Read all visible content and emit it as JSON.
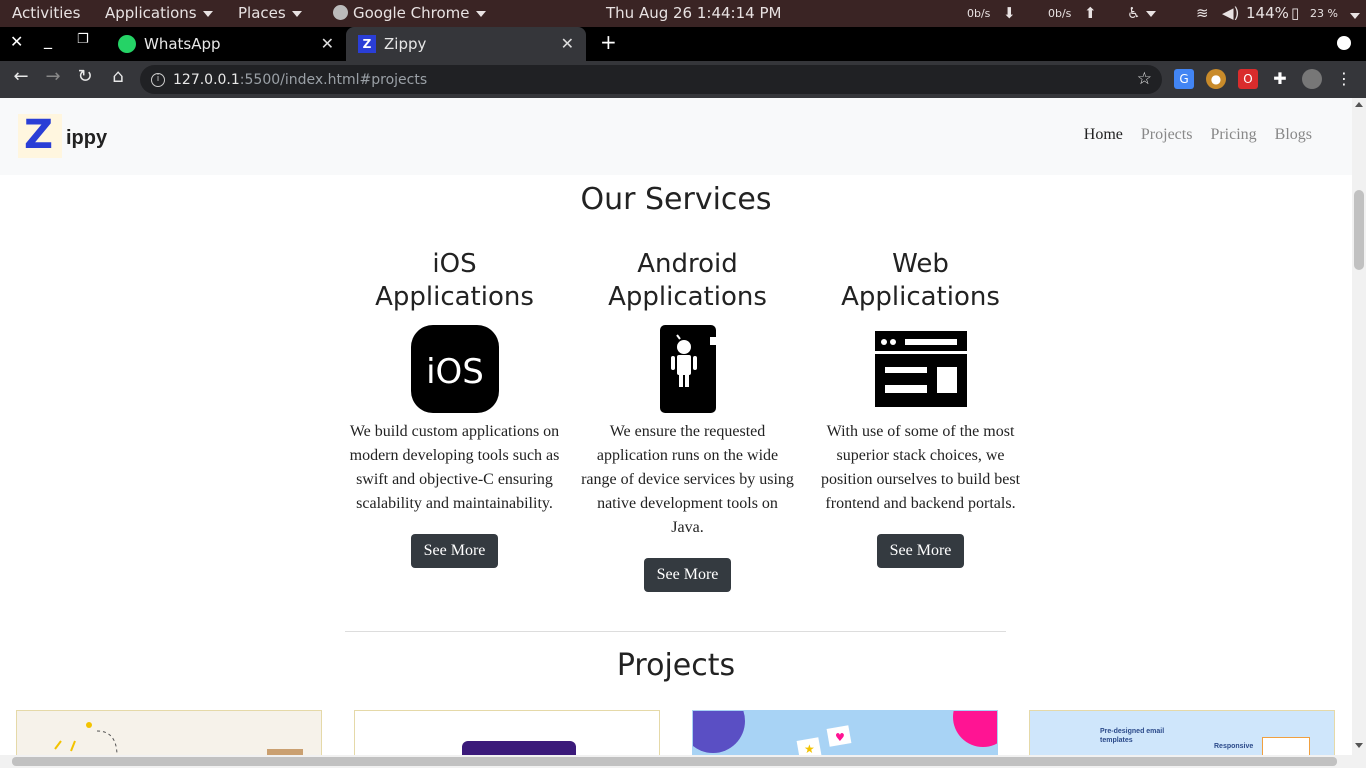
{
  "system_bar": {
    "activities": "Activities",
    "applications": "Applications",
    "places": "Places",
    "app_name": "Google Chrome",
    "datetime": "Thu Aug 26   1:44:14 PM",
    "net_down": "0b/s",
    "net_up": "0b/s",
    "volume": "144%",
    "battery": "23 %"
  },
  "tabs": [
    {
      "title": "WhatsApp",
      "active": false
    },
    {
      "title": "Zippy",
      "active": true
    }
  ],
  "omnibox": {
    "host": "127.0.0.1",
    "path": ":5500/index.html#projects"
  },
  "site": {
    "brand": "ippy",
    "brand_logo_letter": "Z",
    "nav": [
      "Home",
      "Projects",
      "Pricing",
      "Blogs"
    ],
    "services_title": "Our Services",
    "services": [
      {
        "title_line1": "iOS",
        "title_line2": "Applications",
        "icon": "ios-icon",
        "text": "We build custom applications on modern developing tools such as swift and objective-C ensuring scalability and maintainability.",
        "button": "See More"
      },
      {
        "title_line1": "Android",
        "title_line2": "Applications",
        "icon": "android-phone-icon",
        "text": "We ensure the requested application runs on the wide range of device services by using native development tools on Java.",
        "button": "See More"
      },
      {
        "title_line1": "Web",
        "title_line2": "Applications",
        "icon": "web-layout-icon",
        "text": "With use of some of the most superior stack choices, we position ourselves to build best frontend and backend portals.",
        "button": "See More"
      }
    ],
    "projects_title": "Projects",
    "project_thumb_texts": [
      "Pre-designed email templates",
      "Responsive"
    ]
  },
  "colors": {
    "button": "#343a40",
    "navbar": "#f8f9fa",
    "topbar": "#3a2424",
    "logo": "#2a3ed6"
  }
}
